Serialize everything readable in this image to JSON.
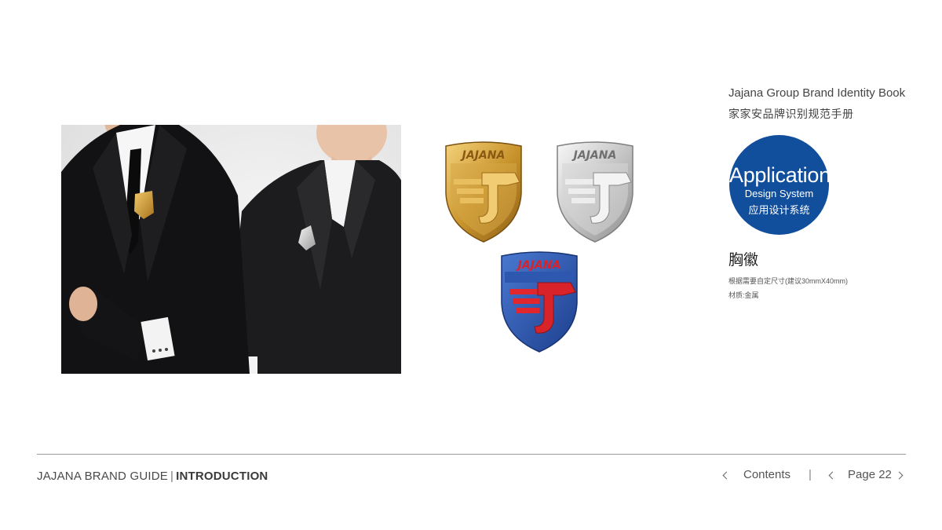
{
  "header": {
    "book_title_en": "Jajana Group Brand Identity Book",
    "book_title_cn": "家家安品牌识别规范手册"
  },
  "section": {
    "circle_title": "Application",
    "circle_subtitle": "Design System",
    "circle_cn": "应用设计系统",
    "circle_color": "#114e9c",
    "heading": "胸徽",
    "note_size": "根据需要自定尺寸(建议30mmX40mm)",
    "note_material": "材质:金属"
  },
  "badges": [
    {
      "name": "gold",
      "wordmark": "JAJANA",
      "color": "#c9952e"
    },
    {
      "name": "silver",
      "wordmark": "JAJANA",
      "color": "#bfbfbf"
    },
    {
      "name": "blue",
      "wordmark": "JAJANA",
      "color": "#2e57b0",
      "accent": "#d8232a"
    }
  ],
  "footer": {
    "brand_guide": "JAJANA BRAND GUIDE",
    "separator": "|",
    "chapter": "INTRODUCTION",
    "contents_label": "Contents",
    "nav_separator": "|",
    "page_label": "Page",
    "page_number": "22"
  }
}
